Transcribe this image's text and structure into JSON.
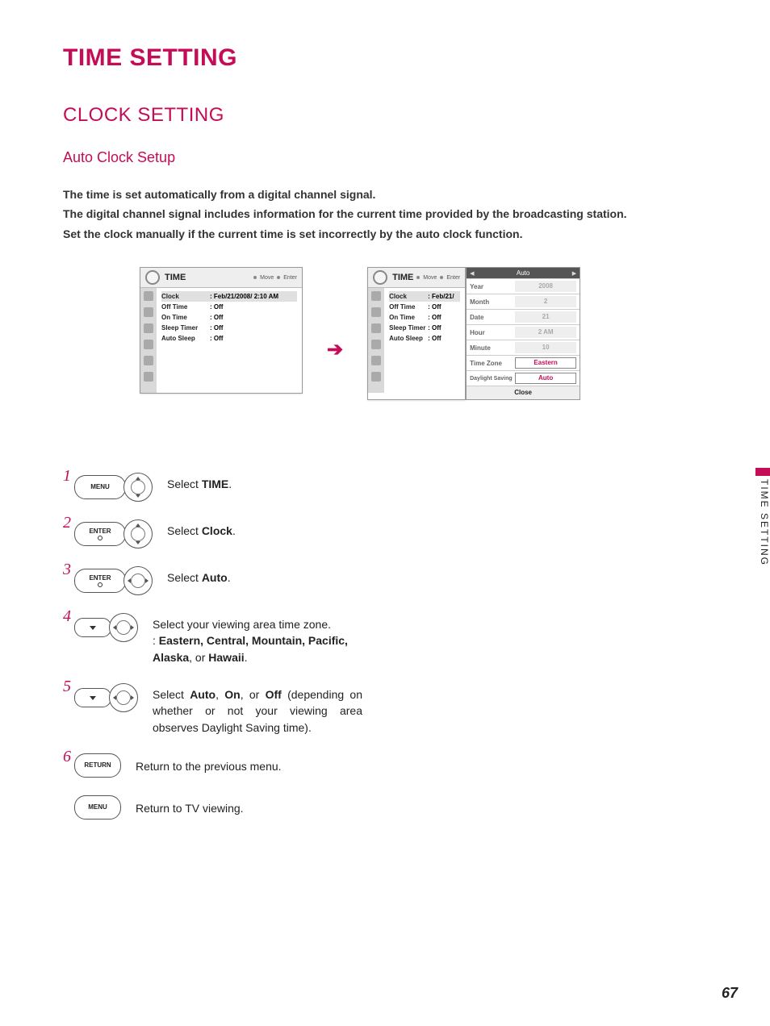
{
  "page": {
    "mainTitle": "TIME SETTING",
    "sectionTitle": "CLOCK SETTING",
    "subTitle": "Auto Clock Setup",
    "body1": "The time is set automatically from a digital channel signal.",
    "body2": "The digital channel signal includes information for the current time provided by the broadcasting station.",
    "body3": "Set the clock manually if the current time is set incorrectly by the auto clock function.",
    "pageNumber": "67",
    "sideTab": "TIME SETTING"
  },
  "osdLeft": {
    "title": "TIME",
    "hintMove": "Move",
    "hintEnter": "Enter",
    "rows": [
      {
        "label": "Clock",
        "value": ": Feb/21/2008/ 2:10 AM",
        "selected": true
      },
      {
        "label": "Off Time",
        "value": ": Off"
      },
      {
        "label": "On Time",
        "value": ": Off"
      },
      {
        "label": "Sleep Timer",
        "value": ": Off"
      },
      {
        "label": "Auto Sleep",
        "value": ": Off"
      }
    ]
  },
  "osdRight": {
    "title": "TIME",
    "hintMove": "Move",
    "hintEnter": "Enter",
    "rows": [
      {
        "label": "Clock",
        "value": ": Feb/21/",
        "selected": true
      },
      {
        "label": "Off Time",
        "value": ": Off"
      },
      {
        "label": "On Time",
        "value": ": Off"
      },
      {
        "label": "Sleep Timer",
        "value": ": Off"
      },
      {
        "label": "Auto Sleep",
        "value": ": Off"
      }
    ]
  },
  "detail": {
    "head": "Auto",
    "rows": [
      {
        "label": "Year",
        "value": "2008"
      },
      {
        "label": "Month",
        "value": "2"
      },
      {
        "label": "Date",
        "value": "21"
      },
      {
        "label": "Hour",
        "value": "2 AM"
      },
      {
        "label": "Minute",
        "value": "10"
      },
      {
        "label": "Time Zone",
        "value": "Eastern",
        "active": true
      },
      {
        "label": "Daylight Saving",
        "value": "Auto",
        "active": true
      }
    ],
    "close": "Close"
  },
  "steps": {
    "s1": {
      "btn": "MENU",
      "textPrefix": "Select ",
      "textBold": "TIME",
      "textSuffix": "."
    },
    "s2": {
      "btn": "ENTER",
      "textPrefix": "Select ",
      "textBold": "Clock",
      "textSuffix": "."
    },
    "s3": {
      "btn": "ENTER",
      "textPrefix": "Select ",
      "textBold": "Auto",
      "textSuffix": "."
    },
    "s4": {
      "line1": "Select your viewing area time zone.",
      "line2prefix": ": ",
      "opts": "Eastern, Central, Mountain, Pacific, Alaska",
      "line2mid": ", or ",
      "opt2": "Hawaii",
      "line2suffix": "."
    },
    "s5": {
      "pre": "Select ",
      "o1": "Auto",
      "sep1": ", ",
      "o2": "On",
      "sep2": ", or ",
      "o3": "Off",
      "post": " (depending on whether or not your viewing area observes Daylight Saving time)."
    },
    "s6": {
      "btn": "RETURN",
      "text": "Return to the previous menu."
    },
    "s7": {
      "btn": "MENU",
      "text": "Return to TV viewing."
    }
  }
}
